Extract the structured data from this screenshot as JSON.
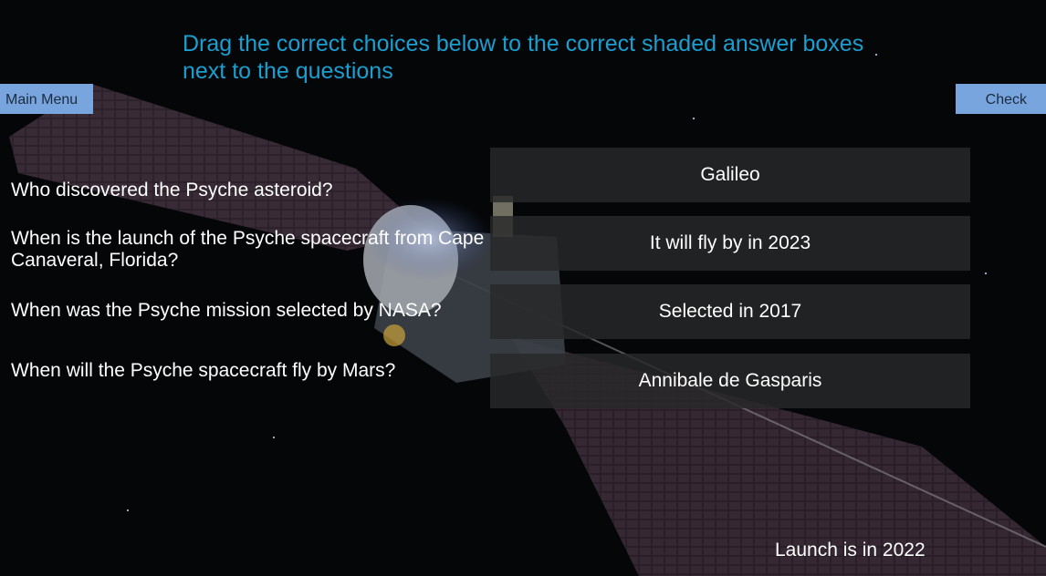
{
  "instruction": "Drag the correct choices below to the correct shaded answer boxes next to the questions",
  "buttons": {
    "main_menu": "Main Menu",
    "check": "Check"
  },
  "questions": [
    "Who discovered the Psyche asteroid?",
    "When is the launch of the Psyche spacecraft from Cape Canaveral, Florida?",
    "When was the Psyche mission selected by NASA?",
    "When will the Psyche spacecraft fly by Mars?"
  ],
  "answer_slots": [
    "Galileo",
    "It will fly by in 2023",
    "Selected in 2017",
    "Annibale de Gasparis"
  ],
  "unplaced_choice": "Launch is in 2022",
  "colors": {
    "instruction": "#1b9fd0",
    "button": "#78a5de",
    "slot": "#28282a"
  }
}
